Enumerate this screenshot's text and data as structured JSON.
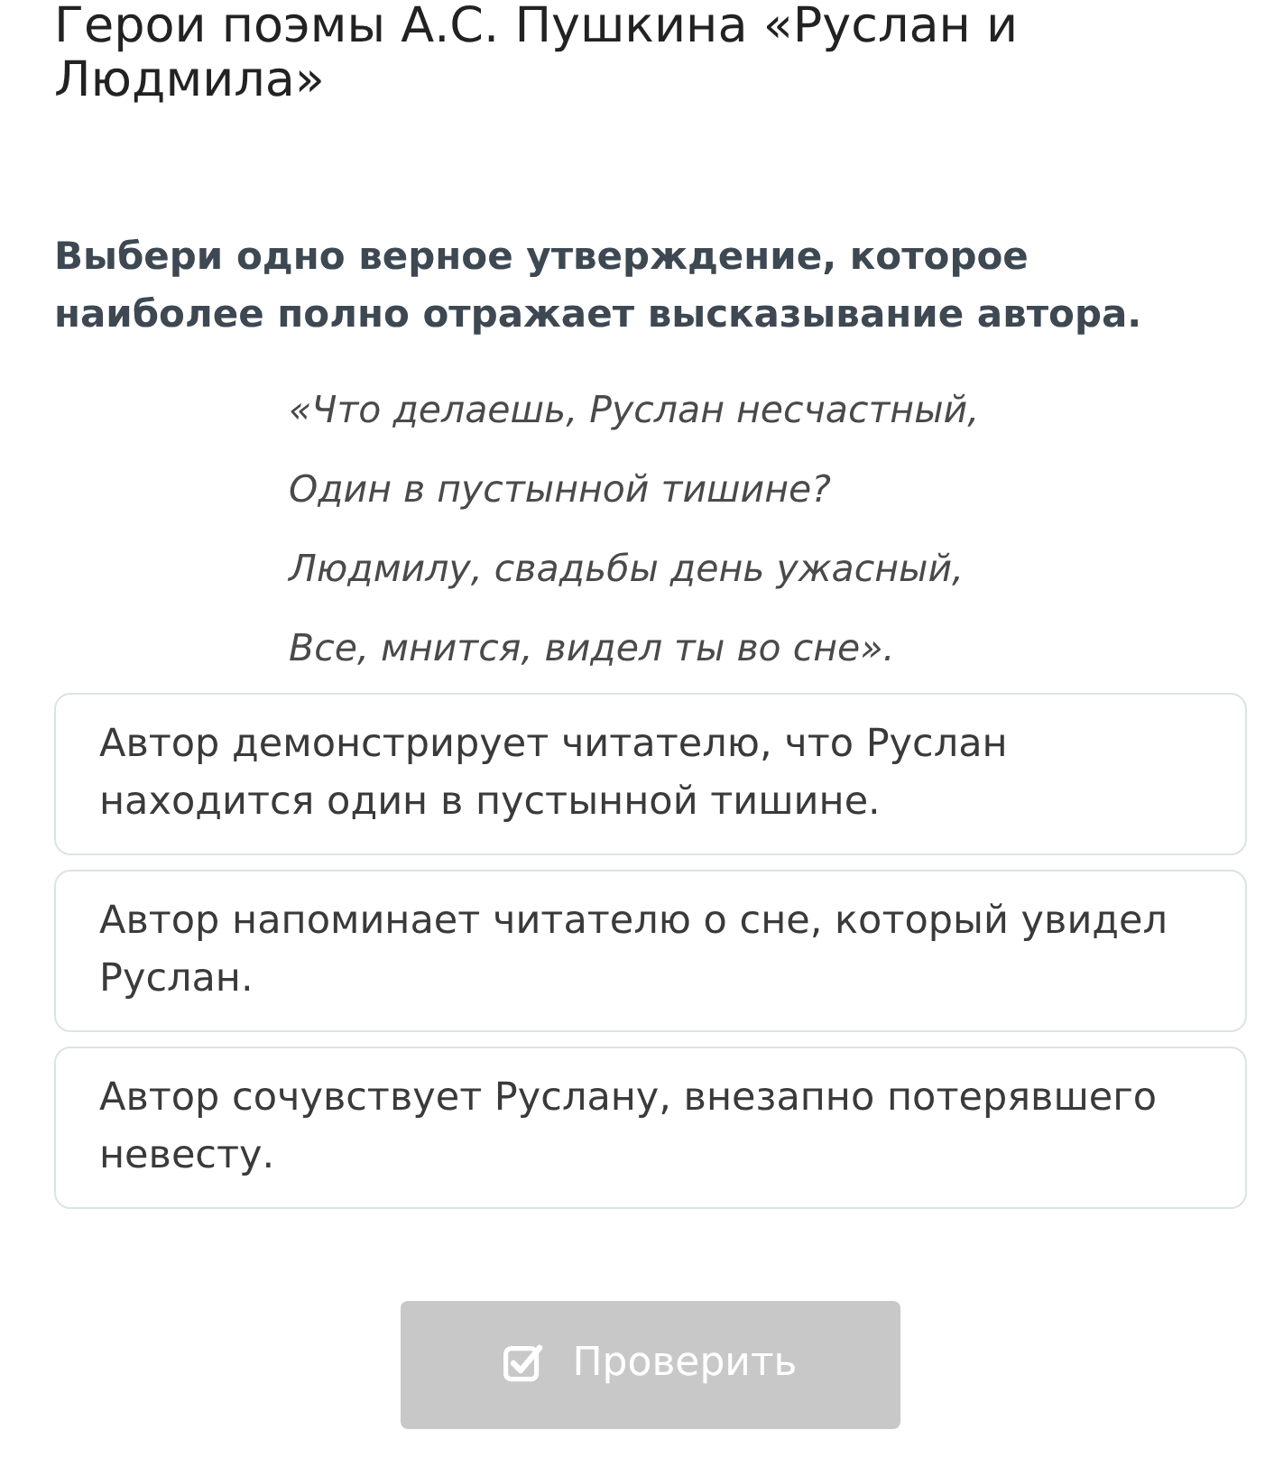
{
  "title": "Герои поэмы А.С. Пушкина «Руслан и Людмила»",
  "question": "Выбери одно верное утверждение, которое наиболее полно отражает высказывание автора.",
  "quote": {
    "lines": [
      "«Что делаешь, Руслан несчастный,",
      "Один в пустынной тишине?",
      "Людмилу, свадьбы день ужасный,",
      "Все, мнится, видел ты во сне»."
    ]
  },
  "options": [
    {
      "text": "Автор демонстрирует читателю, что Руслан находится один в пустынной тишине.",
      "selected": false
    },
    {
      "text": "Автор напоминает читателю о сне, который увидел Руслан.",
      "selected": false
    },
    {
      "text": "Автор сочувствует Руслану, внезапно потерявшего невесту.",
      "selected": false
    }
  ],
  "check_button": {
    "label": "Проверить",
    "disabled": true
  }
}
